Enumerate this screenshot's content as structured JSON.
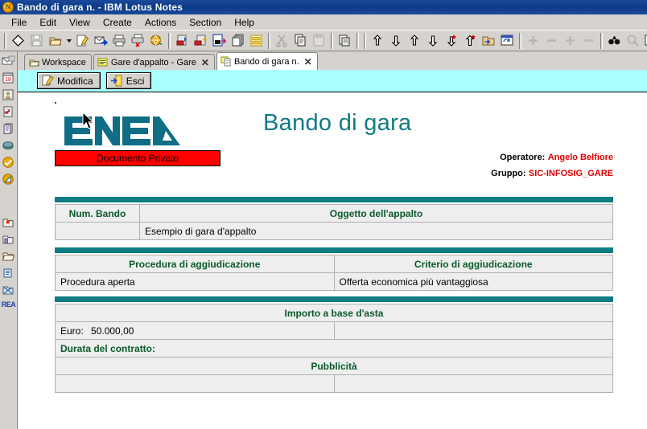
{
  "window": {
    "title": "Bando di gara n.  - IBM Lotus Notes",
    "icon": "lotus-notes-icon"
  },
  "menu": {
    "items": [
      {
        "label": "File"
      },
      {
        "label": "Edit"
      },
      {
        "label": "View"
      },
      {
        "label": "Create"
      },
      {
        "label": "Actions"
      },
      {
        "label": "Section"
      },
      {
        "label": "Help"
      }
    ]
  },
  "toolbar": {
    "groups": [
      {
        "icons": [
          "diamond-icon",
          "save-icon",
          "open-folder-icon",
          "dropdown-arrow-icon",
          "edit-document-icon",
          "send-mail-icon",
          "print-icon",
          "print-preview-icon",
          "web-globe-icon"
        ]
      },
      {
        "icons": [
          "import-pdf-icon",
          "export-pdf-icon",
          "document-export-icon",
          "copy-documents-icon",
          "list-lines-icon"
        ]
      },
      {
        "icons": [
          "cut-icon",
          "copy-icon",
          "paste-icon"
        ]
      },
      {
        "icons": [
          "paste-special-icon"
        ]
      },
      {
        "icons": [
          "collapse-all-icon",
          "expand-all-icon",
          "move-up-icon",
          "move-down-icon",
          "unread-down-icon",
          "unread-up-icon",
          "folder-move-icon",
          "window-refresh-icon"
        ]
      },
      {
        "icons": [
          "plus-icon",
          "minus-icon",
          "plus-large-icon",
          "minus-large-icon"
        ]
      },
      {
        "icons": [
          "find-binoculars-icon",
          "search-magnifier-icon",
          "properties-icon"
        ]
      }
    ]
  },
  "sidebar": {
    "bookmarks": [
      {
        "name": "mail-icon"
      },
      {
        "name": "calendar-icon"
      },
      {
        "name": "contacts-icon"
      },
      {
        "name": "todo-icon"
      },
      {
        "name": "databases-icon"
      },
      {
        "name": "replication-icon"
      },
      {
        "name": "favorites-icon"
      },
      {
        "name": "workspace-icon"
      },
      {
        "name": "recent-databases-icon"
      },
      {
        "name": "folder-bookmark-icon"
      },
      {
        "name": "folder-open-icon"
      },
      {
        "name": "archive-icon"
      },
      {
        "name": "more-bookmarks-icon"
      }
    ],
    "label": "REA"
  },
  "tabs": [
    {
      "label": "Workspace",
      "icon": "workspace-icon",
      "active": false,
      "closable": false
    },
    {
      "label": "Gare d'appalto - Gare",
      "icon": "database-view-icon",
      "active": false,
      "closable": true,
      "close": "✕"
    },
    {
      "label": "Bando di gara n.",
      "icon": "document-icon",
      "active": true,
      "closable": true,
      "close": "✕"
    }
  ],
  "action_bar": {
    "buttons": [
      {
        "label": "Modifica",
        "icon": "edit-pencil-icon"
      },
      {
        "label": "Esci",
        "icon": "exit-door-icon"
      }
    ]
  },
  "document": {
    "logo_alt": "ENEA",
    "title": "Bando di gara",
    "privacy_badge": "Documento Privato",
    "operator_label": "Operatore:",
    "operator_value": "Angelo Belfiore",
    "group_label": "Gruppo:",
    "group_value": "SIC-INFOSIG_GARE",
    "table1": {
      "headers": [
        "Num. Bando",
        "Oggetto dell'appalto"
      ],
      "row": [
        "",
        "Esempio di gara d'appalto"
      ]
    },
    "table2": {
      "headers": [
        "Procedura di aggiudicazione",
        "Criterio di aggiudicazione"
      ],
      "row": [
        "Procedura aperta",
        "Offerta economica più vantaggiosa"
      ]
    },
    "table3": {
      "header": "Importo a base d'asta",
      "euro_label": "Euro:",
      "euro_value": "50.000,00",
      "euro_right": "",
      "durata_label": "Durata del contratto:",
      "pubblicita_header": "Pubblicità"
    }
  },
  "colors": {
    "titlebar": "#0d3a85",
    "teal": "#0f7c84",
    "action_bar": "#aaffff",
    "badge_red": "#ff0000",
    "header_green": "#0a5a2a",
    "operator_red": "#e00000",
    "chrome": "#d6d3ce"
  }
}
